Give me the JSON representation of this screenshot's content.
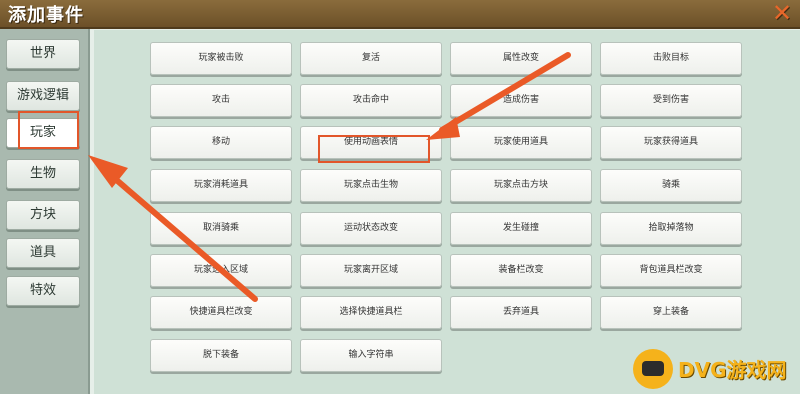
{
  "window": {
    "title": "添加事件"
  },
  "sidebar": {
    "items": [
      {
        "label": "世界"
      },
      {
        "label": "游戏逻辑"
      },
      {
        "label": "玩家",
        "selected": true
      },
      {
        "label": "生物"
      },
      {
        "label": "方块"
      },
      {
        "label": "道具"
      },
      {
        "label": "特效"
      }
    ]
  },
  "events": [
    "玩家被击败",
    "复活",
    "属性改变",
    "击败目标",
    "攻击",
    "攻击命中",
    "造成伤害",
    "受到伤害",
    "移动",
    "使用动画表情",
    "玩家使用道具",
    "玩家获得道具",
    "玩家消耗道具",
    "玩家点击生物",
    "玩家点击方块",
    "骑乘",
    "取消骑乘",
    "运动状态改变",
    "发生碰撞",
    "拾取掉落物",
    "玩家进入区域",
    "玩家离开区域",
    "装备栏改变",
    "背包道具栏改变",
    "快捷道具栏改变",
    "选择快捷道具栏",
    "丢弃道具",
    "穿上装备",
    "脱下装备",
    "输入字符串"
  ],
  "highlighted_event": "使用动画表情",
  "colors": {
    "accent": "#e2562a",
    "titlebar": "#7a5c30",
    "logo": "#f5b21b"
  },
  "watermark": {
    "text": "DVG游戏网"
  }
}
